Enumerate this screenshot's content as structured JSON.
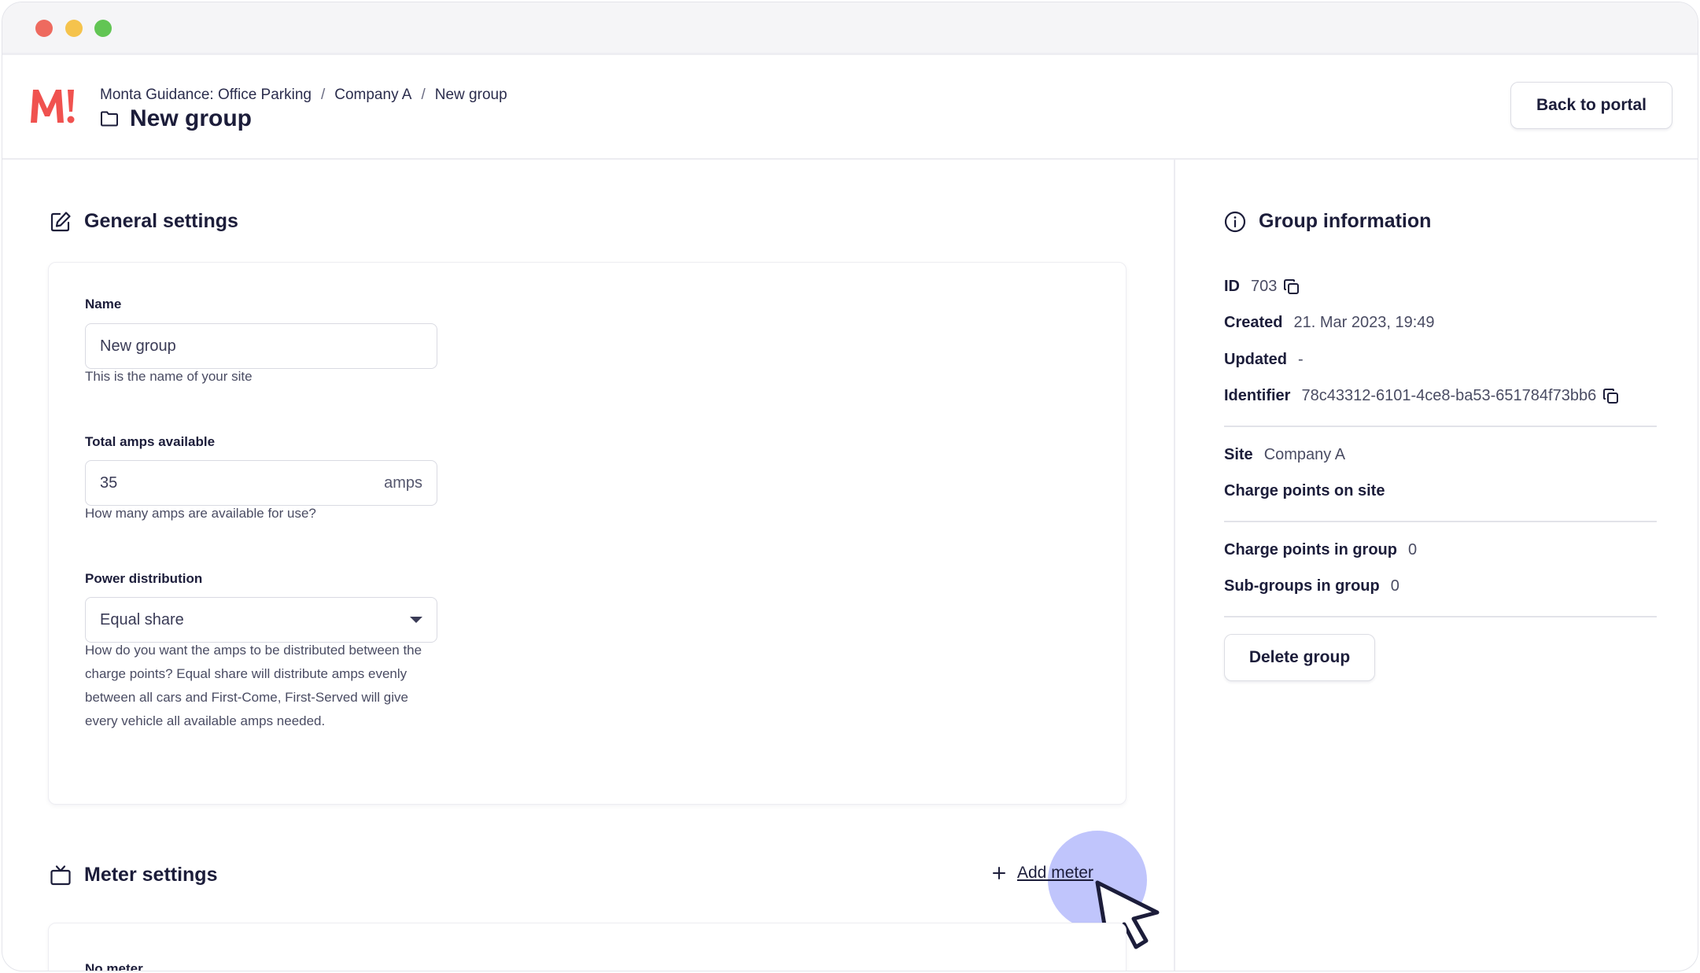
{
  "window": {
    "controls": [
      "close",
      "minimize",
      "maximize"
    ]
  },
  "header": {
    "logo_text": "M!",
    "breadcrumb": [
      "Monta Guidance: Office Parking",
      "Company A",
      "New group"
    ],
    "breadcrumb_separator": "/",
    "title": "New group",
    "title_icon": "folder-icon",
    "back_button": "Back to portal"
  },
  "general": {
    "heading": "General settings",
    "heading_icon": "edit-icon",
    "name": {
      "label": "Name",
      "value": "New group",
      "help": "This is the name of your site"
    },
    "amps": {
      "label": "Total amps available",
      "value": "35",
      "suffix": "amps",
      "help": "How many amps are available for use?"
    },
    "power": {
      "label": "Power distribution",
      "value": "Equal share",
      "help": "How do you want the amps to be distributed between the charge points? Equal share will distribute amps evenly between all cars and First-Come, First-Served will give every vehicle all available amps needed."
    }
  },
  "meter": {
    "heading": "Meter settings",
    "heading_icon": "tv-icon",
    "add_label": "Add meter",
    "add_icon": "plus-icon",
    "empty_text": "No meter"
  },
  "info": {
    "heading": "Group information",
    "heading_icon": "info-icon",
    "id_label": "ID",
    "id_value": "703",
    "created_label": "Created",
    "created_value": "21. Mar 2023, 19:49",
    "updated_label": "Updated",
    "updated_value": "-",
    "identifier_label": "Identifier",
    "identifier_value": "78c43312-6101-4ce8-ba53-651784f73bb6",
    "site_label": "Site",
    "site_value": "Company A",
    "charge_points_site_label": "Charge points on site",
    "charge_points_group_label": "Charge points in group",
    "charge_points_group_value": "0",
    "subgroups_label": "Sub-groups in group",
    "subgroups_value": "0",
    "delete_button": "Delete group"
  },
  "colors": {
    "brand": "#f0524f",
    "text": "#1c1d3a",
    "cursor_highlight": "#8c96fa"
  }
}
